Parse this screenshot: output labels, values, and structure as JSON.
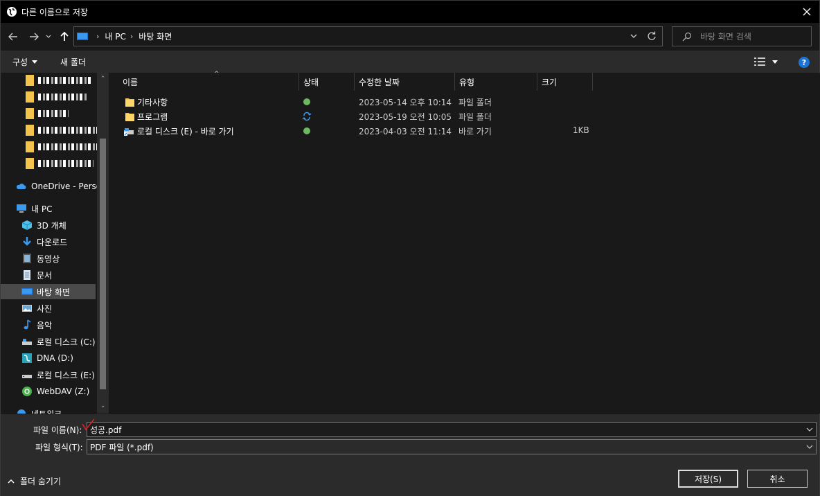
{
  "window": {
    "title": "다른 이름으로 저장"
  },
  "address": {
    "crumbs": [
      "내 PC",
      "바탕 화면"
    ]
  },
  "search": {
    "placeholder": "바탕 화면 검색"
  },
  "toolbar": {
    "organize": "구성",
    "new_folder": "새 폴더"
  },
  "navpane": {
    "items": [
      {
        "label": "OneDrive - Persor",
        "icon": "onedrive-icon"
      },
      {
        "label": "내 PC",
        "icon": "pc-icon"
      },
      {
        "label": "3D 개체",
        "icon": "cube-icon"
      },
      {
        "label": "다운로드",
        "icon": "download-icon"
      },
      {
        "label": "동영상",
        "icon": "video-icon"
      },
      {
        "label": "문서",
        "icon": "document-icon"
      },
      {
        "label": "바탕 화면",
        "icon": "desktop-icon",
        "selected": true
      },
      {
        "label": "사진",
        "icon": "picture-icon"
      },
      {
        "label": "음악",
        "icon": "music-icon"
      },
      {
        "label": "로컬 디스크 (C:)",
        "icon": "drive-icon"
      },
      {
        "label": "DNA (D:)",
        "icon": "network-drive-icon"
      },
      {
        "label": "로컬 디스크 (E:)",
        "icon": "drive-icon"
      },
      {
        "label": "WebDAV (Z:)",
        "icon": "webdav-icon"
      },
      {
        "label": "네트워크",
        "icon": "network-icon"
      }
    ]
  },
  "columns": {
    "name": "이름",
    "status": "상태",
    "modified": "수정한 날짜",
    "type": "유형",
    "size": "크기"
  },
  "files": [
    {
      "name": "기타사항",
      "status": "synced",
      "modified": "2023-05-14 오후 10:14",
      "type": "파일 폴더",
      "size": ""
    },
    {
      "name": "프로그램",
      "status": "syncing",
      "modified": "2023-05-19 오전 10:05",
      "type": "파일 폴더",
      "size": ""
    },
    {
      "name": "로컬 디스크 (E) - 바로 가기",
      "status": "synced",
      "modified": "2023-04-03 오전 11:14",
      "type": "바로 가기",
      "size": "1KB"
    }
  ],
  "bottom": {
    "filename_label": "파일 이름(N):",
    "filename_value": "성공.pdf",
    "filetype_label": "파일 형식(T):",
    "filetype_value": "PDF 파일 (*.pdf)",
    "hide_folders": "폴더 숨기기",
    "save": "저장(S)",
    "cancel": "취소"
  },
  "colors": {
    "accent": "#1e74d5",
    "folder": "#f3c34b",
    "status_ok": "#6cb960"
  }
}
